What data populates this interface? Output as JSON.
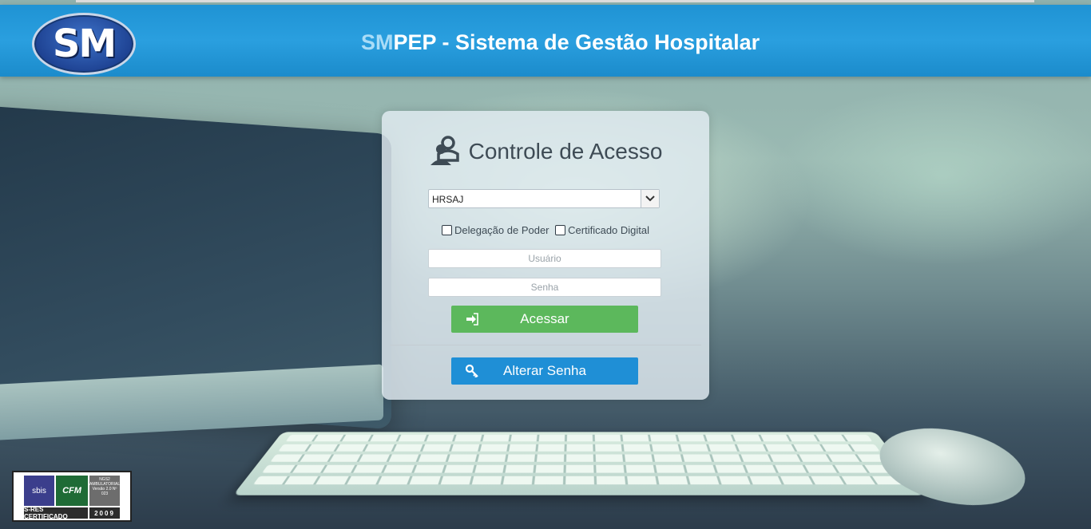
{
  "header": {
    "logo_text": "SM",
    "title_accent": "SM",
    "title_rest": "PEP - Sistema de Gestão Hospitalar"
  },
  "login": {
    "heading": "Controle de Acesso",
    "unit_select_value": "HRSAJ",
    "option_delegacao": "Delegação de Poder",
    "option_certificado": "Certificado Digital",
    "username_placeholder": "Usuário",
    "password_placeholder": "Senha",
    "submit_label": "Acessar",
    "change_password_label": "Alterar Senha"
  },
  "badge": {
    "sbis": "sbis",
    "cfm": "CFM",
    "nges_text": "NGS2 AMBULATORIAL Versão 2.0 Nº 023",
    "certified": "S-RES CERTIFICADO",
    "year": "2009"
  },
  "colors": {
    "header_blue": "#1f93d4",
    "accent_light_blue": "#a9dcf7",
    "submit_green": "#5cb85c",
    "change_password_blue": "#1f8fd6"
  }
}
